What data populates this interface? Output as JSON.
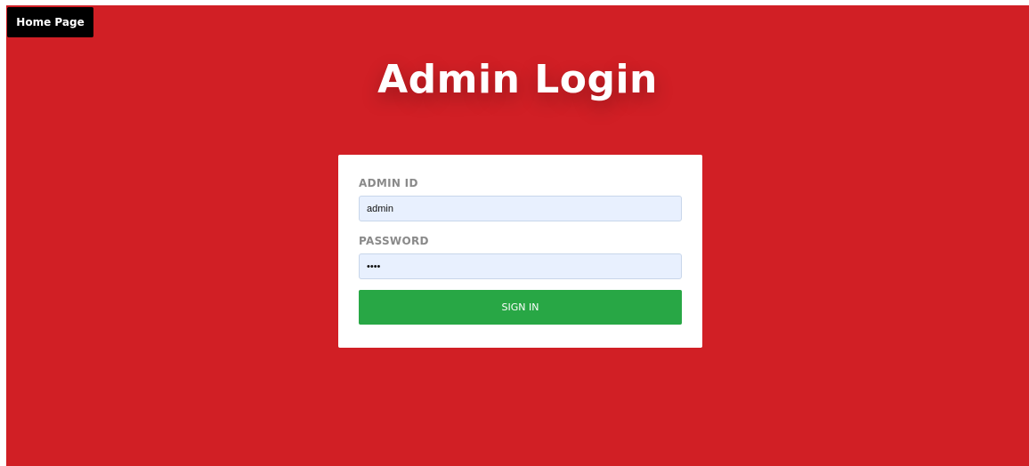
{
  "header": {
    "home_button_label": "Home Page"
  },
  "login": {
    "title": "Admin Login",
    "admin_id_label": "ADMIN ID",
    "admin_id_value": "admin",
    "password_label": "PASSWORD",
    "password_value": "abcd",
    "signin_label": "SIGN IN"
  },
  "colors": {
    "background": "#d11f25",
    "home_button_bg": "#000000",
    "input_bg": "#e8f0fe",
    "signin_bg": "#28a745"
  }
}
